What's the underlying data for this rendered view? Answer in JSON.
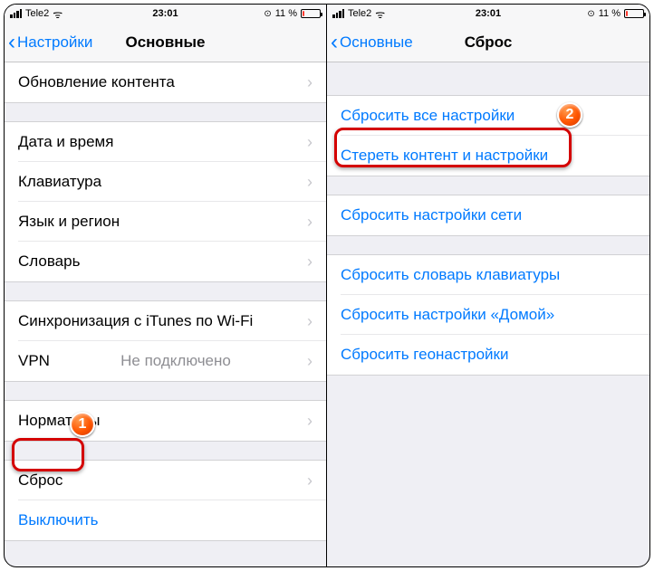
{
  "status": {
    "carrier": "Tele2",
    "time": "23:01",
    "battery_pct": "11 %",
    "lock_glyph": "⊙",
    "wifi_glyph": "ᯤ"
  },
  "left": {
    "back_label": "Настройки",
    "title": "Основные",
    "partial_top": "Обновление контента",
    "group1": {
      "r1": "Дата и время",
      "r2": "Клавиатура",
      "r3": "Язык и регион",
      "r4": "Словарь"
    },
    "group2": {
      "r1": "Синхронизация с iTunes по Wi-Fi",
      "r2": "VPN",
      "r2_detail": "Не подключено"
    },
    "group3": {
      "r1": "Нормативы"
    },
    "group4": {
      "r1": "Сброс",
      "r2": "Выключить"
    },
    "annotation_number": "1"
  },
  "right": {
    "back_label": "Основные",
    "title": "Сброс",
    "group1": {
      "r1": "Сбросить все настройки",
      "r2": "Стереть контент и настройки"
    },
    "group2": {
      "r1": "Сбросить настройки сети"
    },
    "group3": {
      "r1": "Сбросить словарь клавиатуры",
      "r2": "Сбросить настройки «Домой»",
      "r3": "Сбросить геонастройки"
    },
    "annotation_number": "2"
  }
}
